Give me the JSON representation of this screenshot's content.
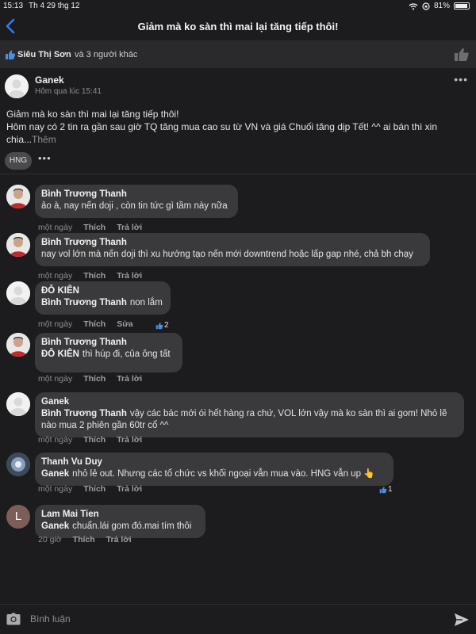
{
  "status_bar": {
    "time": "15:13",
    "date": "Th 4 29 thg 12",
    "battery": "81%"
  },
  "header": {
    "title": "Giảm mà ko sàn thì mai lại tăng tiếp thôi!",
    "back_icon": "chevron-left-icon"
  },
  "likes": {
    "liker": "Siêu Thị Sơn",
    "others": "và 3 người khác"
  },
  "post": {
    "author": "Ganek",
    "time": "Hôm qua lúc 15:41",
    "line1": "Giảm mà ko sàn thì mai lại tăng tiếp thôi!",
    "line2": "Hôm nay có 2 tin ra gần sau giờ TQ tăng mua cao su từ VN và giá Chuối tăng dịp Tết! ^^ ai bán thì xin",
    "line3": "chia...",
    "see_more": "Thêm",
    "tag": "HNG"
  },
  "comments": [
    {
      "author": "Bình Trương Thanh",
      "mention": "",
      "text": "ảo à, nay nến doji , còn tin tức gì tầm này nữa",
      "time": "một ngày",
      "like": "Thích",
      "reply": "Trả lời",
      "reactions": ""
    },
    {
      "author": "Bình Trương Thanh",
      "mention": "",
      "text": "nay vol lớn mà nến doji thì xu hướng tạo nến mới downtrend hoặc lấp gap nhé, chả bh chạy",
      "time": "một ngày",
      "like": "Thích",
      "reply": "Trả lời",
      "reactions": ""
    },
    {
      "author": "ĐỖ KIÊN",
      "mention": "Bình Trương Thanh",
      "text": "non lắm",
      "time": "một ngày",
      "like": "Thích",
      "reply": "Sửa",
      "reactions": "2"
    },
    {
      "author": "Bình Trương Thanh",
      "mention": "ĐỖ KIÊN",
      "text": "thì húp đi, của ông tất",
      "time": "một ngày",
      "like": "Thích",
      "reply": "Trả lời",
      "reactions": ""
    },
    {
      "author": "Ganek",
      "mention": "Bình Trương Thanh",
      "text": "vậy các bác mới ói hết hàng ra chứ, VOL lớn vậy mà ko sàn thì ai gom! Nhỏ lẽ",
      "text2": "nào mua 2 phiên gần 60tr cổ ^^",
      "time": "một ngày",
      "like": "Thích",
      "reply": "Trả lời",
      "reactions": ""
    },
    {
      "author": "Thanh Vu Duy",
      "mention": "Ganek",
      "text": "nhỏ lẻ out. Nhưng các tổ chức vs khối ngoại vẫn mua vào. HNG vẫn up 👆",
      "time": "một ngày",
      "like": "Thích",
      "reply": "Trả lời",
      "reactions": "1"
    },
    {
      "author": "Lam Mai Tien",
      "mention": "Ganek",
      "text": "chuẩn.lái gom đó.mai tím thôi",
      "time": "20 giờ",
      "like": "Thích",
      "reply": "Trả lời",
      "reactions": "",
      "avatar_letter": "L"
    }
  ],
  "composer": {
    "placeholder": "Bình luận"
  },
  "colors": {
    "accent": "#2f7ff5",
    "background": "#1c1c1e",
    "bubble": "#3a3a3c"
  }
}
